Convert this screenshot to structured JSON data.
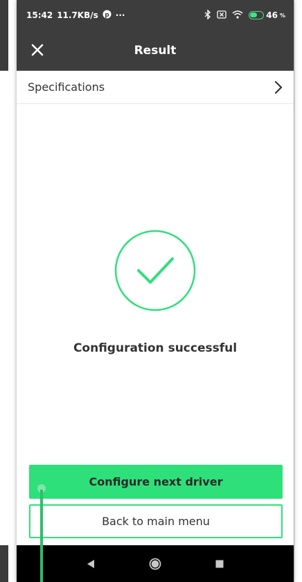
{
  "status_bar": {
    "time": "15:42",
    "speed": "11.7KB/s",
    "dots": "···",
    "battery": "46"
  },
  "app_bar": {
    "title": "Result"
  },
  "specifications": {
    "label": "Specifications"
  },
  "result": {
    "message": "Configuration successful"
  },
  "actions": {
    "primary_label": "Configure next driver",
    "secondary_label": "Back to main menu"
  },
  "colors": {
    "accent": "#2ee07a",
    "app_bar": "#3d3d3d",
    "nav_bar": "#000000"
  },
  "icons": [
    "close-icon",
    "chevron-right-icon",
    "checkmark-circle-icon",
    "back-nav-icon",
    "home-nav-icon",
    "recents-nav-icon"
  ]
}
